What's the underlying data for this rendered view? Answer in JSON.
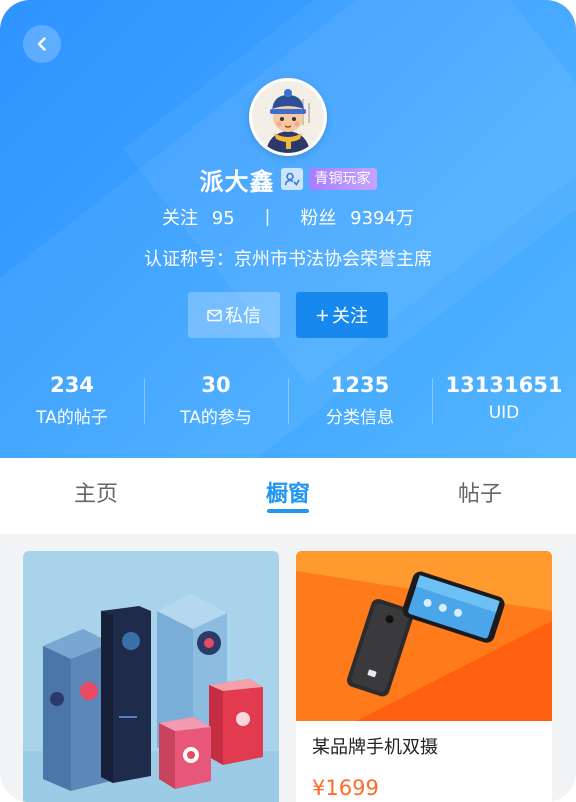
{
  "profile": {
    "name": "派大鑫",
    "level_badge": "青铜玩家",
    "follow_label": "关注",
    "follow_count": "95",
    "separator": "|",
    "fans_label": "粉丝",
    "fans_count": "9394万",
    "certification": "认证称号：京州市书法协会荣誉主席"
  },
  "actions": {
    "message_label": "私信",
    "follow_button_label": "关注"
  },
  "stats": [
    {
      "value": "234",
      "label": "TA的帖子"
    },
    {
      "value": "30",
      "label": "TA的参与"
    },
    {
      "value": "1235",
      "label": "分类信息"
    },
    {
      "value": "13131651",
      "label": "UID"
    }
  ],
  "tabs": [
    {
      "label": "主页",
      "active": false
    },
    {
      "label": "橱窗",
      "active": true
    },
    {
      "label": "帖子",
      "active": false
    }
  ],
  "products": [
    {
      "title": "",
      "price": ""
    },
    {
      "title": "某品牌手机双摄",
      "price": "¥1699"
    }
  ],
  "icons": {
    "back": "chevron-left-icon",
    "verify": "verified-person-icon",
    "mail": "mail-icon",
    "plus": "plus-icon"
  },
  "colors": {
    "header_gradient_start": "#2f93ff",
    "header_gradient_end": "#55b6ff",
    "accent": "#2196f3",
    "follow_button": "#1688ee",
    "level_badge": "#b48cff",
    "price": "#ff6a2b"
  }
}
